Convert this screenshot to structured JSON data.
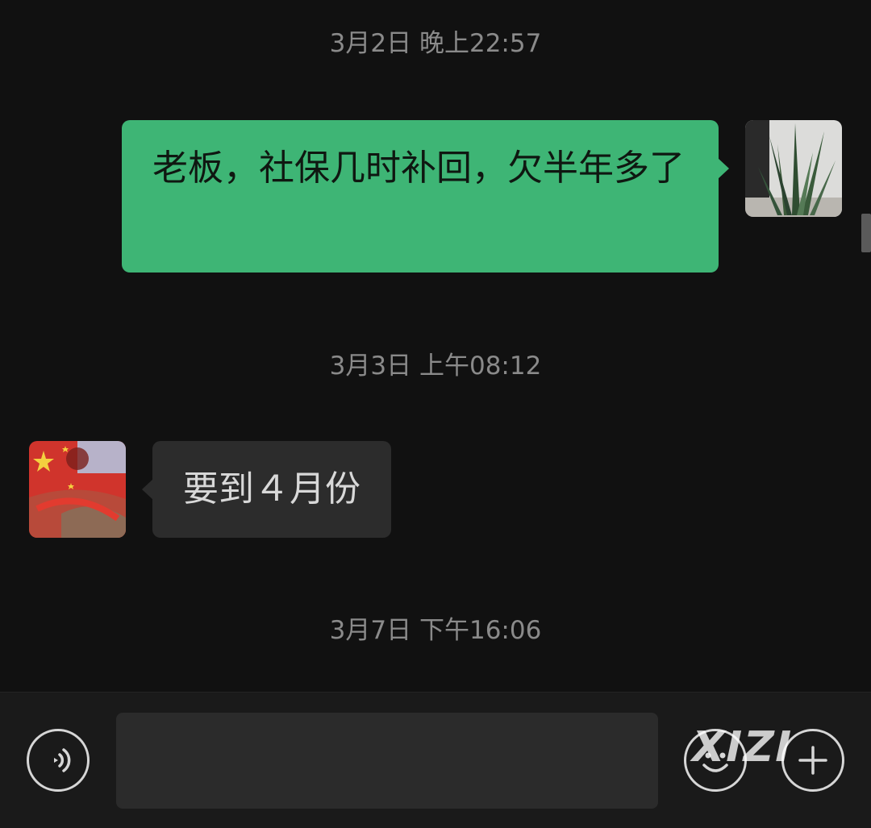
{
  "messages": [
    {
      "timestamp": "3月2日 晚上22:57",
      "direction": "outgoing",
      "text": "老板，社保几时补回，欠半年多了"
    },
    {
      "timestamp": "3月3日 上午08:12",
      "direction": "incoming",
      "text": "要到４月份"
    },
    {
      "timestamp": "3月7日 下午16:06"
    }
  ],
  "input_bar": {
    "voice_icon": "voice-waves-icon",
    "text_value": "",
    "emoji_icon": "smiley-face-icon",
    "more_icon": "plus-icon"
  },
  "watermark": "XIZI",
  "colors": {
    "background": "#111111",
    "outgoing_bubble": "#3eb575",
    "incoming_bubble": "#2c2c2c",
    "timestamp_text": "#8a8a8a"
  }
}
